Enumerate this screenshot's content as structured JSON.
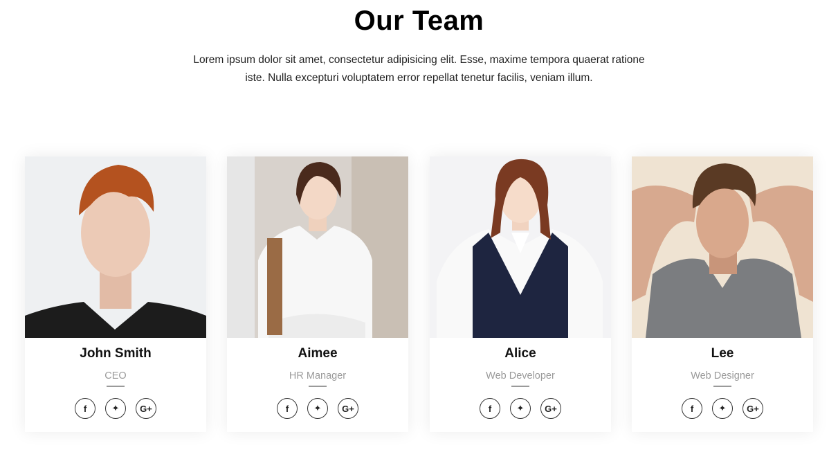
{
  "section": {
    "title": "Our Team",
    "intro": "Lorem ipsum dolor sit amet, consectetur adipisicing elit. Esse, maxime tempora quaerat ratione iste. Nulla excepturi voluptatem error repellat tenetur facilis, veniam illum."
  },
  "social_icons": {
    "facebook": "f",
    "twitter": "✦",
    "google_plus": "G+"
  },
  "members": [
    {
      "name": "John Smith",
      "role": "CEO"
    },
    {
      "name": "Aimee",
      "role": "HR Manager"
    },
    {
      "name": "Alice",
      "role": "Web Developer"
    },
    {
      "name": "Lee",
      "role": "Web Designer"
    }
  ]
}
